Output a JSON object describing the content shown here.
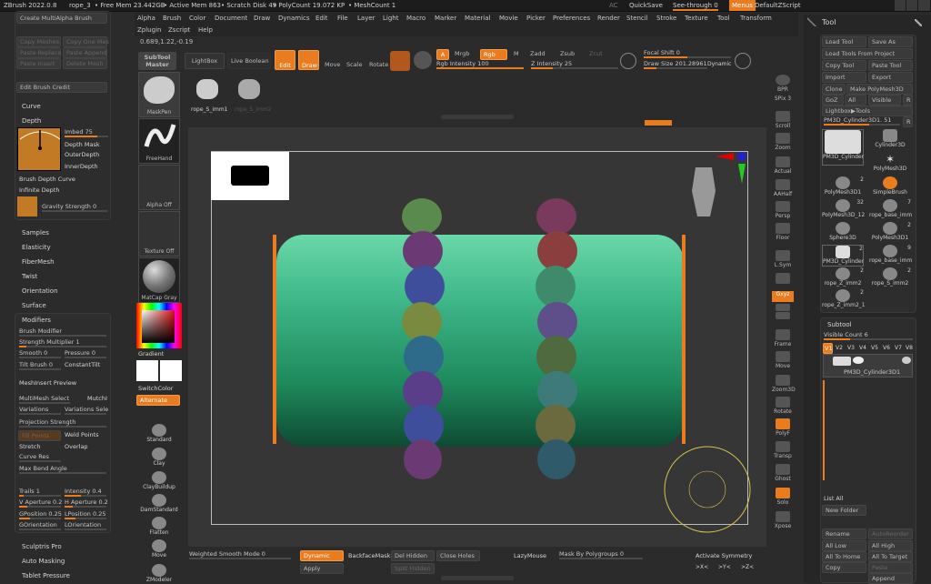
{
  "topbar": {
    "app": "ZBrush 2022.0.8",
    "doc": "rope_3",
    "freemem": "• Free Mem 23.442GB",
    "activemem": "• Active Mem 863",
    "scratch": "• Scratch Disk 49",
    "poly": "• PolyCount 19.072 KP",
    "mesh": "• MeshCount 1",
    "ac": "AC",
    "quicksave": "QuickSave",
    "seethrough": "See-through 0",
    "menus": "Menus",
    "script": "DefaultZScript"
  },
  "menu": {
    "row1": [
      "Alpha",
      "Brush",
      "Color",
      "Document",
      "Draw",
      "Dynamics",
      "Edit",
      "File",
      "Layer",
      "Light",
      "Macro",
      "Marker",
      "Material",
      "Movie",
      "Picker",
      "Preferences",
      "Render",
      "Stencil",
      "Stroke",
      "Texture",
      "Tool",
      "Transform"
    ],
    "row2": [
      "Zplugin",
      "Zscript",
      "Help"
    ],
    "coords": "0.689,1.22,-0.19"
  },
  "left": {
    "create_multialpha": "Create MultiAlpha Brush",
    "copy_meshes": "Copy Meshes",
    "copy_one_mesh": "Copy One Mes",
    "paste_replace": "Paste Replace",
    "paste_append": "Paste Append",
    "paste_insert": "Paste Insert",
    "delete_mesh": "Delete Mesh",
    "edit_brush_credit": "Edit Brush Credit",
    "curve": "Curve",
    "depth": "Depth",
    "imbed": "Imbed 75",
    "depth_mask": "Depth Mask",
    "outer_depth": "OuterDepth",
    "inner_depth": "InnerDepth",
    "brush_depth_curve": "Brush Depth Curve",
    "infinite_depth": "Infinite Depth",
    "gravity_strength": "Gravity Strength 0",
    "samples": "Samples",
    "elasticity": "Elasticity",
    "fibermesh": "FiberMesh",
    "twist": "Twist",
    "orientation": "Orientation",
    "surface": "Surface",
    "modifiers": "Modifiers",
    "brush_modifier": "Brush Modifier",
    "strength_multiplier": "Strength Multiplier 1",
    "smooth": "Smooth 0",
    "pressure": "Pressure 0",
    "tilt_brush": "Tilt Brush 0",
    "constant_tilt": "ConstantTilt",
    "meshinsert_preview": "MeshInsert Preview",
    "multimesh_select": "MultiMesh Select",
    "mutch": "MutchI",
    "variations": "Variations",
    "variations_sel": "Variations Sele",
    "projection_strength": "Projection Strength",
    "fill_points": "Fill Points",
    "weld_points": "Weld Points",
    "stretch": "Stretch",
    "overlap": "Overlap",
    "curve_res": "Curve Res",
    "max_bend_angle": "Max Bend Angle",
    "trails": "Trails 1",
    "intensity": "Intensity 0.4",
    "v_aperture": "V Aperture 0.2",
    "h_aperture": "H Aperture 0.2",
    "gposition": "GPosition 0.25",
    "lposition": "LPosition 0.25",
    "gorientation": "GOrientation",
    "lorientation": "LOrientation",
    "sculptris_pro": "Sculptris Pro",
    "auto_masking": "Auto Masking",
    "tablet_pressure": "Tablet Pressure"
  },
  "shelf": {
    "subtool_master": "SubTool Master",
    "lightbox": "LightBox",
    "live_boolean": "Live Boolean",
    "maskpen": "MaskPen",
    "freehand": "FreeHand",
    "alpha_off": "Alpha Off",
    "texture_off": "Texture Off",
    "matcap": "MatCap Gray",
    "gradient": "Gradient",
    "switchcolor": "SwitchColor",
    "alternate": "Alternate",
    "brushes": [
      "Standard",
      "Clay",
      "ClayBuildup",
      "DamStandard",
      "Flatten",
      "Move",
      "ZModeler"
    ],
    "brush_count": "1"
  },
  "toolbar": {
    "edit": "Edit",
    "draw": "Draw",
    "move": "Move",
    "scale": "Scale",
    "rotate": "Rotate",
    "a": "A",
    "mrgb": "Mrgb",
    "rgb": "Rgb",
    "m": "M",
    "zadd": "Zadd",
    "zsub": "Zsub",
    "zcut": "Zcut",
    "rgb_intensity": "Rgb Intensity 100",
    "z_intensity": "Z Intensity 25",
    "focal_shift": "Focal Shift 0",
    "draw_size": "Draw Size 201.28961",
    "dynamic": "Dynamic"
  },
  "meshes": {
    "item1": "rope_S_imm1",
    "item2": "rope_S_imm2"
  },
  "bottom": {
    "weighted_smooth": "Weighted Smooth Mode 0",
    "dynamic": "Dynamic",
    "apply": "Apply",
    "backface_mask": "BackfaceMask",
    "del_hidden": "Del Hidden",
    "split_hidden": "Split Hidden",
    "close_holes": "Close Holes",
    "lazymouse": "LazyMouse",
    "mask_by_polygroups": "Mask By Polygroups 0",
    "activate_symmetry": "Activate Symmetry",
    "sym_x": ">X<",
    "sym_y": ">Y<",
    "sym_z": ">Z<"
  },
  "right_rail": [
    "BPR",
    "SPix 3",
    "Scroll",
    "Zoom",
    "Actual",
    "AAHalf",
    "Persp",
    "Floor",
    "L.Sym",
    "Local",
    "Gxyz",
    "Frame",
    "Move",
    "Zoom3D",
    "Rotate",
    "PolyF",
    "Transp",
    "Ghost",
    "Solo",
    "Xpose"
  ],
  "tool": {
    "title": "Tool",
    "load_tool": "Load Tool",
    "save_as": "Save As",
    "load_from_project": "Load Tools From Project",
    "copy_tool": "Copy Tool",
    "paste_tool": "Paste Tool",
    "import": "Import",
    "export": "Export",
    "clone": "Clone",
    "make_polymesh": "Make PolyMesh3D",
    "goz": "GoZ",
    "all": "All",
    "visible": "Visible",
    "r": "R",
    "lightbox_tools": "Lightbox▶Tools",
    "current": "PM3D_Cylinder3D1. 51",
    "items": [
      {
        "name": "PM3D_Cylinder",
        "n": ""
      },
      {
        "name": "Cylinder3D",
        "n": ""
      },
      {
        "name": "PolyMesh3D",
        "n": ""
      },
      {
        "name": "PolyMesh3D1",
        "n": "2"
      },
      {
        "name": "SimpleBrush",
        "n": ""
      },
      {
        "name": "PolyMesh3D_12",
        "n": "32"
      },
      {
        "name": "rope_base_imm",
        "n": "7"
      },
      {
        "name": "Sphere3D",
        "n": "2"
      },
      {
        "name": "PolyMesh3D1",
        "n": "2"
      },
      {
        "name": "PM3D_Cylinder",
        "n": "2"
      },
      {
        "name": "rope_base_imm",
        "n": "9"
      },
      {
        "name": "rope_Z_imm2",
        "n": "2"
      },
      {
        "name": "rope_S_imm2",
        "n": "2"
      },
      {
        "name": "rope_Z_imm2_1",
        "n": "2"
      }
    ]
  },
  "subtool": {
    "title": "Subtool",
    "visible_count": "Visible Count 6",
    "versions": [
      "V1",
      "V2",
      "V3",
      "V4",
      "V5",
      "V6",
      "V7",
      "V8"
    ],
    "item": "PM3D_Cylinder3D1",
    "list_all": "List All",
    "new_folder": "New Folder",
    "rename": "Rename",
    "autoreorder": "AutoReorder",
    "all_low": "All Low",
    "all_high": "All High",
    "all_to_home": "All To Home",
    "all_to_target": "All To Target",
    "copy": "Copy",
    "paste": "Paste",
    "append": "Append"
  }
}
